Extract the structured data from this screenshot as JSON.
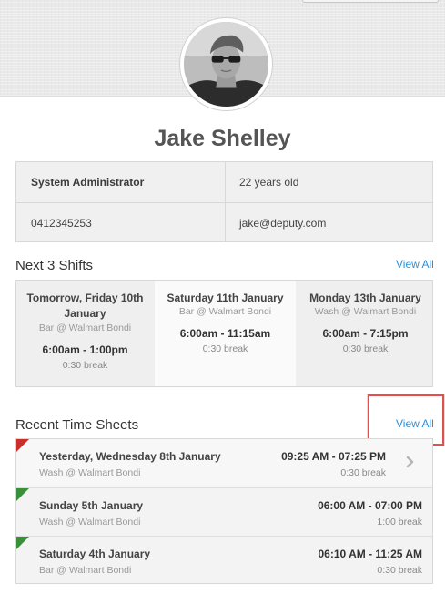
{
  "profile": {
    "name": "Jake Shelley",
    "role": "System Administrator",
    "age": "22 years old",
    "phone": "0412345253",
    "email": "jake@deputy.com"
  },
  "shifts": {
    "title": "Next 3 Shifts",
    "view_all": "View All",
    "items": [
      {
        "day_line1": "Tomorrow, Friday 10th",
        "day_line2": "January",
        "location": "Bar @ Walmart Bondi",
        "time": "6:00am - 1:00pm",
        "break": "0:30 break"
      },
      {
        "day_line1": "Saturday 11th January",
        "day_line2": "",
        "location": "Bar @ Walmart Bondi",
        "time": "6:00am - 11:15am",
        "break": "0:30 break"
      },
      {
        "day_line1": "Monday 13th January",
        "day_line2": "",
        "location": "Wash @ Walmart Bondi",
        "time": "6:00am - 7:15pm",
        "break": "0:30 break"
      }
    ]
  },
  "timesheets": {
    "title": "Recent Time Sheets",
    "view_all": "View All",
    "items": [
      {
        "day": "Yesterday, Wednesday 8th January",
        "location": "Wash @ Walmart Bondi",
        "time": "09:25 AM - 07:25 PM",
        "break": "0:30 break",
        "status_color": "#c9302c"
      },
      {
        "day": "Sunday 5th January",
        "location": "Wash @ Walmart Bondi",
        "time": "06:00 AM - 07:00 PM",
        "break": "1:00 break",
        "status_color": "#3a8f3a"
      },
      {
        "day": "Saturday 4th January",
        "location": "Bar @ Walmart Bondi",
        "time": "06:10 AM - 11:25 AM",
        "break": "0:30 break",
        "status_color": "#3a8f3a"
      }
    ]
  },
  "colors": {
    "link": "#2e8fd6",
    "highlight": "#d9534f"
  },
  "icons": {
    "row_action": "chevron-right-icon"
  }
}
